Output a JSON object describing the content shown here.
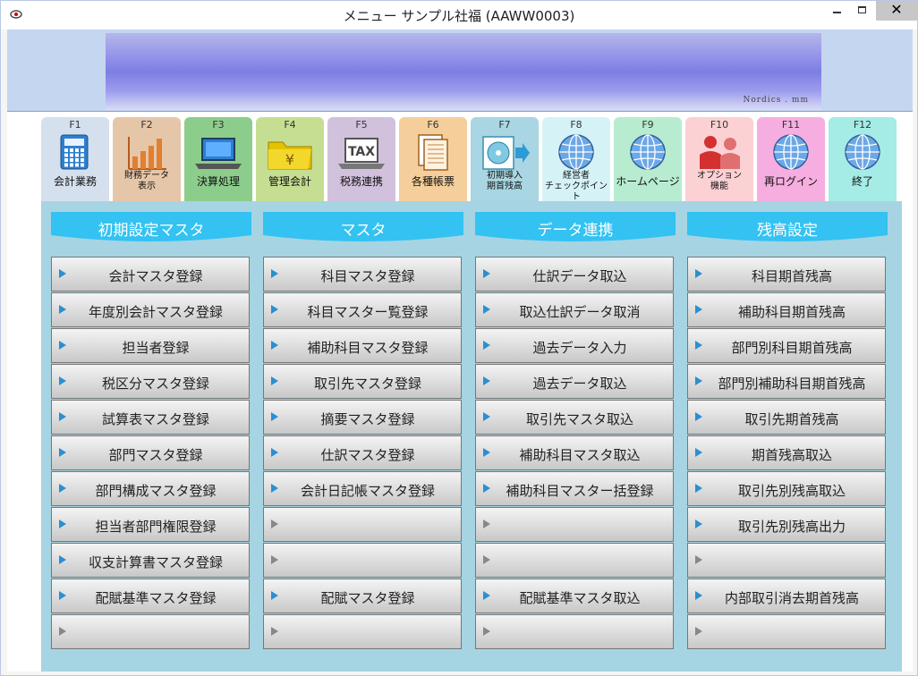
{
  "window": {
    "title": "メニュー サンプル社福 (AAWW0003)",
    "close_glyph": "✕"
  },
  "banner": {
    "caption": "Nordics . mm"
  },
  "function_keys": [
    {
      "key": "F1",
      "label": "会計業務",
      "icon": "calculator-icon",
      "color": "#d5e0ee"
    },
    {
      "key": "F2",
      "label": "財務データ表示",
      "lines": [
        "財務データ",
        "表示"
      ],
      "icon": "bar-chart-icon",
      "color": "#e6c6a8"
    },
    {
      "key": "F3",
      "label": "決算処理",
      "icon": "laptop-icon",
      "color": "#8ccd8c"
    },
    {
      "key": "F4",
      "label": "管理会計",
      "icon": "yen-folder-icon",
      "color": "#c6de91"
    },
    {
      "key": "F5",
      "label": "税務連携",
      "icon": "tax-icon",
      "color": "#d2c1dd"
    },
    {
      "key": "F6",
      "label": "各種帳票",
      "icon": "documents-icon",
      "color": "#f5cf9b"
    },
    {
      "key": "F7",
      "label": "初期導入期首残高",
      "lines": [
        "初期導入",
        "期首残高"
      ],
      "icon": "disc-arrow-icon",
      "color": "#a9d6e2"
    },
    {
      "key": "F8",
      "label": "経営者チェックポイント",
      "lines": [
        "経営者",
        "チェックポイント"
      ],
      "icon": "globe-icon",
      "color": "#d5f3f7"
    },
    {
      "key": "F9",
      "label": "ホームページ",
      "icon": "globe-icon",
      "color": "#b8ecd0"
    },
    {
      "key": "F10",
      "label": "オプション機能",
      "lines": [
        "オプション",
        "機能"
      ],
      "icon": "users-icon",
      "color": "#fbd1d4"
    },
    {
      "key": "F11",
      "label": "再ログイン",
      "icon": "globe-icon",
      "color": "#f6aee0"
    },
    {
      "key": "F12",
      "label": "終了",
      "icon": "globe-icon",
      "color": "#a4ece5"
    }
  ],
  "columns": [
    {
      "header": "初期設定マスタ",
      "buttons": [
        "会計マスタ登録",
        "年度別会計マスタ登録",
        "担当者登録",
        "税区分マスタ登録",
        "試算表マスタ登録",
        "部門マスタ登録",
        "部門構成マスタ登録",
        "担当者部門権限登録",
        "収支計算書マスタ登録",
        "配賦基準マスタ登録",
        ""
      ]
    },
    {
      "header": "マスタ",
      "buttons": [
        "科目マスタ登録",
        "科目マスター覧登録",
        "補助科目マスタ登録",
        "取引先マスタ登録",
        "摘要マスタ登録",
        "仕訳マスタ登録",
        "会計日記帳マスタ登録",
        "",
        "",
        "配賦マスタ登録",
        ""
      ]
    },
    {
      "header": "データ連携",
      "buttons": [
        "仕訳データ取込",
        "取込仕訳データ取消",
        "過去データ入力",
        "過去データ取込",
        "取引先マスタ取込",
        "補助科目マスタ取込",
        "補助科目マスター括登録",
        "",
        "",
        "配賦基準マスタ取込",
        ""
      ]
    },
    {
      "header": "残高設定",
      "buttons": [
        "科目期首残高",
        "補助科目期首残高",
        "部門別科目期首残高",
        "部門別補助科目期首残高",
        "取引先期首残高",
        "期首残高取込",
        "取引先別残高取込",
        "取引先別残高出力",
        "",
        "内部取引消去期首残高",
        ""
      ]
    }
  ],
  "colors": {
    "panel": "#a6d4e2",
    "header": "#33c2f2",
    "arrow": "#2a8fd1"
  }
}
